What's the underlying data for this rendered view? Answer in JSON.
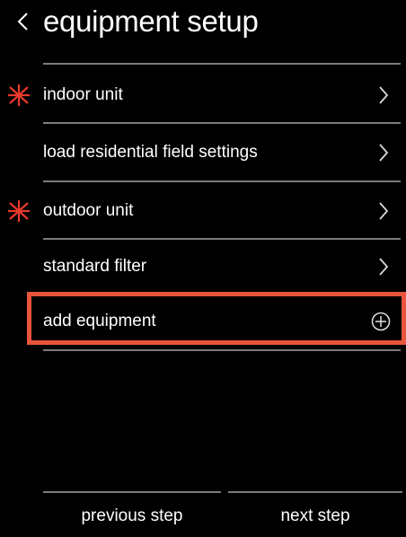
{
  "header": {
    "title": "equipment setup",
    "back_icon": "chevron-left-icon"
  },
  "rows": [
    {
      "label": "indoor unit",
      "required": true,
      "action_icon": "chevron-right-icon"
    },
    {
      "label": "load residential field settings",
      "required": false,
      "action_icon": "chevron-right-icon"
    },
    {
      "label": "outdoor unit",
      "required": true,
      "action_icon": "chevron-right-icon"
    },
    {
      "label": "standard filter",
      "required": false,
      "action_icon": "chevron-right-icon"
    },
    {
      "label": "add equipment",
      "required": false,
      "action_icon": "plus-circle-icon",
      "highlighted": true
    }
  ],
  "footer": {
    "previous_label": "previous step",
    "next_label": "next step"
  },
  "colors": {
    "background": "#000000",
    "divider": "#7c7c7c",
    "required_marker": "#e8392c",
    "highlight": "#e8553c",
    "text": "#ffffff"
  }
}
